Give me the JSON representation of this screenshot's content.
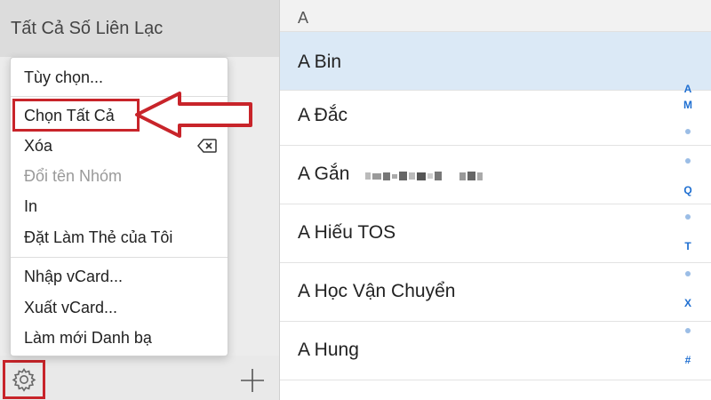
{
  "sidebar": {
    "title": "Tất Cả Số Liên Lạc",
    "footer_icons": [
      "gear-icon",
      "plus-icon"
    ]
  },
  "menu": {
    "items": [
      {
        "label": "Tùy chọn...",
        "enabled": true
      },
      {
        "label": "Chọn Tất Cả",
        "enabled": true,
        "highlighted": true
      },
      {
        "label": "Xóa",
        "enabled": true,
        "icon": "delete-left-icon"
      },
      {
        "label": "Đổi tên Nhóm",
        "enabled": false
      },
      {
        "label": "In",
        "enabled": true
      },
      {
        "label": "Đặt Làm Thẻ của Tôi",
        "enabled": true
      },
      {
        "label": "Nhập vCard...",
        "enabled": true
      },
      {
        "label": "Xuất vCard...",
        "enabled": true
      },
      {
        "label": "Làm mới Danh bạ",
        "enabled": true
      }
    ]
  },
  "contacts": {
    "section": "A",
    "rows": [
      {
        "name": "A Bin",
        "selected": true
      },
      {
        "name": "A Đắc"
      },
      {
        "name": "A Gắn",
        "blurred": true
      },
      {
        "name": "A Hiếu TOS"
      },
      {
        "name": "A Học Vận Chuyển"
      },
      {
        "name": "A Hung"
      }
    ]
  },
  "index": {
    "letters": [
      "A",
      "M",
      "Q",
      "T",
      "X",
      "#"
    ]
  },
  "colors": {
    "accent": "#1f6fd1",
    "highlight": "#c8242a",
    "selected_row": "#dbe9f6"
  }
}
